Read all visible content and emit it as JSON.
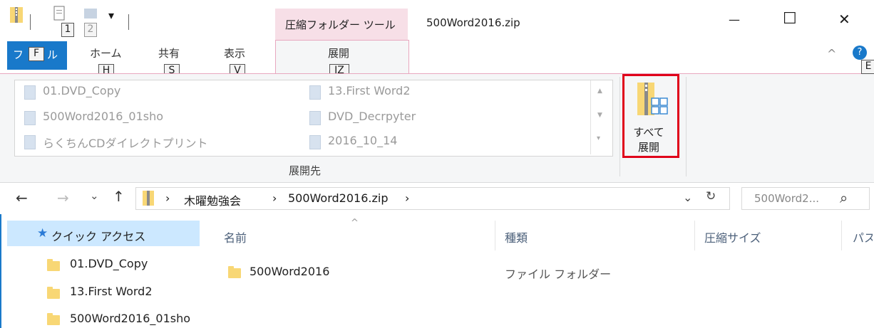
{
  "window": {
    "title": "500Word2016.zip",
    "context_tab": "圧縮フォルダー ツール",
    "controls": {
      "minimize": "—",
      "maximize": "☐",
      "close": "✕"
    }
  },
  "qat": {
    "dropdown": "▾",
    "keytip_1": "1",
    "keytip_2": "2"
  },
  "ribbon_tabs": {
    "file": {
      "label_a": "フ",
      "label_b": "ル",
      "keytip": "F"
    },
    "home": {
      "label": "ホーム",
      "keytip": "H"
    },
    "share": {
      "label": "共有",
      "keytip": "S"
    },
    "view": {
      "label": "表示",
      "keytip": "V"
    },
    "extract": {
      "label": "展開",
      "keytip": "JZ"
    },
    "collapse": "^",
    "help_keytip": "E"
  },
  "ribbon": {
    "destinations": [
      "01.DVD_Copy",
      "500Word2016_01sho",
      "らくちんCDダイレクトプリント",
      "13.First Word2",
      "DVD_Decrpyter",
      "2016_10_14"
    ],
    "group_label": "展開先",
    "extract_all_line1": "すべて",
    "extract_all_line2": "展開"
  },
  "address": {
    "back": "←",
    "forward": "→",
    "recent": "⌄",
    "up": "↑",
    "crumbs": [
      "木曜勉強会",
      "500Word2016.zip"
    ],
    "sep": "›",
    "dropdown": "⌄",
    "refresh": "↻",
    "search_placeholder": "500Word2...",
    "search_icon": "⌕"
  },
  "nav": {
    "quick_access": "クイック アクセス",
    "items": [
      "01.DVD_Copy",
      "13.First Word2",
      "500Word2016_01sho"
    ]
  },
  "list": {
    "columns": [
      "名前",
      "種類",
      "圧縮サイズ",
      "パス"
    ],
    "sort_indicator": "^",
    "rows": [
      {
        "name": "500Word2016",
        "type": "ファイル フォルダー"
      }
    ]
  },
  "colors": {
    "file_tab": "#1979ca",
    "context_tab": "#f7dfe7",
    "highlight_border": "#e0001a",
    "folder": "#f8d775",
    "nav_selected": "#cce8ff"
  }
}
